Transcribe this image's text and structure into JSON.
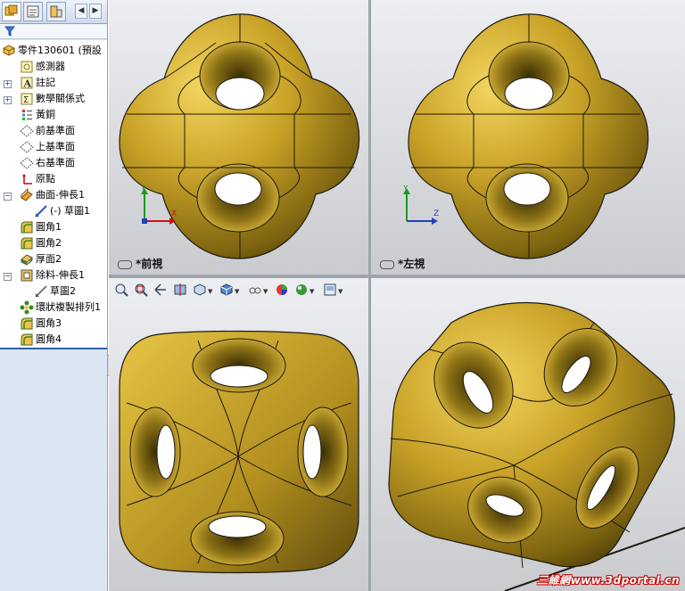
{
  "feature_manager": {
    "tabs": [
      "feature-manager-tab",
      "property-manager-tab",
      "configuration-manager-tab"
    ],
    "filter_icon": "filter-icon",
    "tree": [
      {
        "label": "零件130601 (預設",
        "icon": "part-icon"
      },
      {
        "label": "感測器",
        "icon": "sensor-icon"
      },
      {
        "label": "註記",
        "icon": "annotation-icon"
      },
      {
        "label": "數學關係式",
        "icon": "equation-icon"
      },
      {
        "label": "黃銅",
        "icon": "material-icon"
      },
      {
        "label": "前基準面",
        "icon": "plane-icon"
      },
      {
        "label": "上基準面",
        "icon": "plane-icon"
      },
      {
        "label": "右基準面",
        "icon": "plane-icon"
      },
      {
        "label": "原點",
        "icon": "origin-icon"
      },
      {
        "label": "曲面-伸長1",
        "icon": "surface-extrude-icon"
      },
      {
        "label": "(-) 草圖1",
        "icon": "sketch-icon"
      },
      {
        "label": "圓角1",
        "icon": "fillet-icon"
      },
      {
        "label": "圓角2",
        "icon": "fillet-icon"
      },
      {
        "label": "厚面2",
        "icon": "thicken-icon"
      },
      {
        "label": "除料-伸長1",
        "icon": "cut-extrude-icon"
      },
      {
        "label": "草圖2",
        "icon": "sketch-icon"
      },
      {
        "label": "環狀複製排列1",
        "icon": "circular-pattern-icon"
      },
      {
        "label": "圓角3",
        "icon": "fillet-icon"
      },
      {
        "label": "圓角4",
        "icon": "fillet-icon"
      }
    ]
  },
  "viewports": {
    "front": {
      "label": "*前視"
    },
    "left": {
      "label": "*左視"
    }
  },
  "triad": {
    "y": "Y",
    "x": "X",
    "z": "Z"
  },
  "colors": {
    "model": "#c9a227",
    "edge": "#1e1a10",
    "background_top": "#eceef1",
    "background_bottom": "#c9cbcf",
    "tree_selected": "#2f5fa8"
  },
  "watermark": "三維網www.3dportal.cn"
}
